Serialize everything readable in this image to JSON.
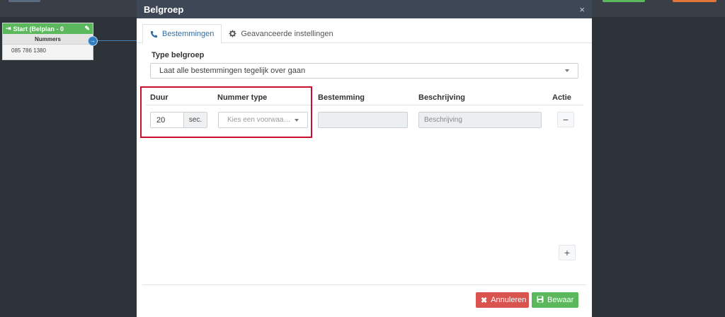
{
  "background": {
    "node": {
      "title": "Start (Belplan - 0",
      "subheader": "Nummers",
      "number": "085 786 1380"
    }
  },
  "modal": {
    "title": "Belgroep",
    "close_glyph": "×",
    "tabs": [
      {
        "label": "Bestemmingen",
        "icon": "phone-icon",
        "active": true
      },
      {
        "label": "Geavanceerde instellingen",
        "icon": "gear-icon",
        "active": false
      }
    ],
    "type_label": "Type belgroep",
    "type_value": "Laat alle bestemmingen tegelijk over gaan",
    "table": {
      "headers": [
        "Duur",
        "Nummer type",
        "Bestemming",
        "Beschrijving",
        "Actie"
      ],
      "row": {
        "duur_value": "20",
        "duur_unit": "sec.",
        "nummer_type_placeholder": "Kies een voorwaarde",
        "bestemming_value": "",
        "beschrijving_placeholder": "Beschrijving"
      }
    },
    "footer": {
      "cancel_label": "Annuleren",
      "save_label": "Bewaar"
    }
  },
  "colors": {
    "header_bg": "#3e4755",
    "accent": "#2f6ea5",
    "danger": "#d9534f",
    "success": "#5cb85c",
    "highlight": "#c8102e"
  }
}
